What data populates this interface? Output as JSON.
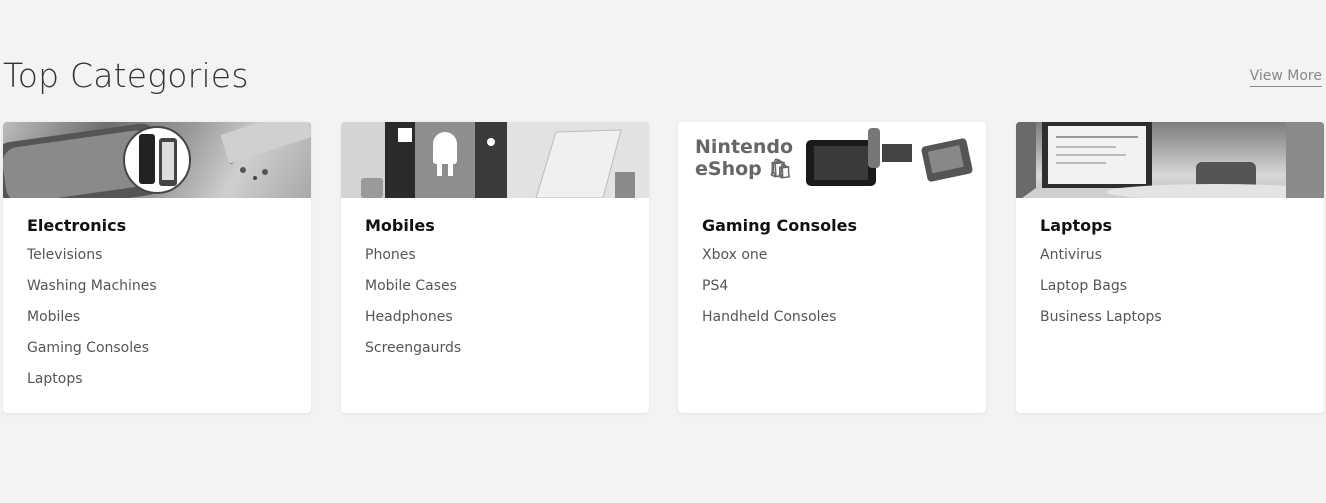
{
  "section": {
    "title": "Top Categories",
    "view_more": "View More"
  },
  "banner_logo": {
    "line1": "Nintendo",
    "line2": "eShop"
  },
  "cards": [
    {
      "title": "Electronics",
      "banner": "electronics-banner-image",
      "items": [
        "Televisions",
        "Washing Machines",
        "Mobiles",
        "Gaming Consoles",
        "Laptops"
      ]
    },
    {
      "title": "Mobiles",
      "banner": "mobiles-banner-image",
      "items": [
        "Phones",
        "Mobile Cases",
        "Headphones",
        "Screengaurds"
      ]
    },
    {
      "title": "Gaming Consoles",
      "banner": "gaming-banner-image",
      "items": [
        "Xbox one",
        "PS4",
        "Handheld Consoles"
      ]
    },
    {
      "title": "Laptops",
      "banner": "laptops-banner-image",
      "items": [
        "Antivirus",
        "Laptop Bags",
        "Business Laptops"
      ]
    }
  ]
}
